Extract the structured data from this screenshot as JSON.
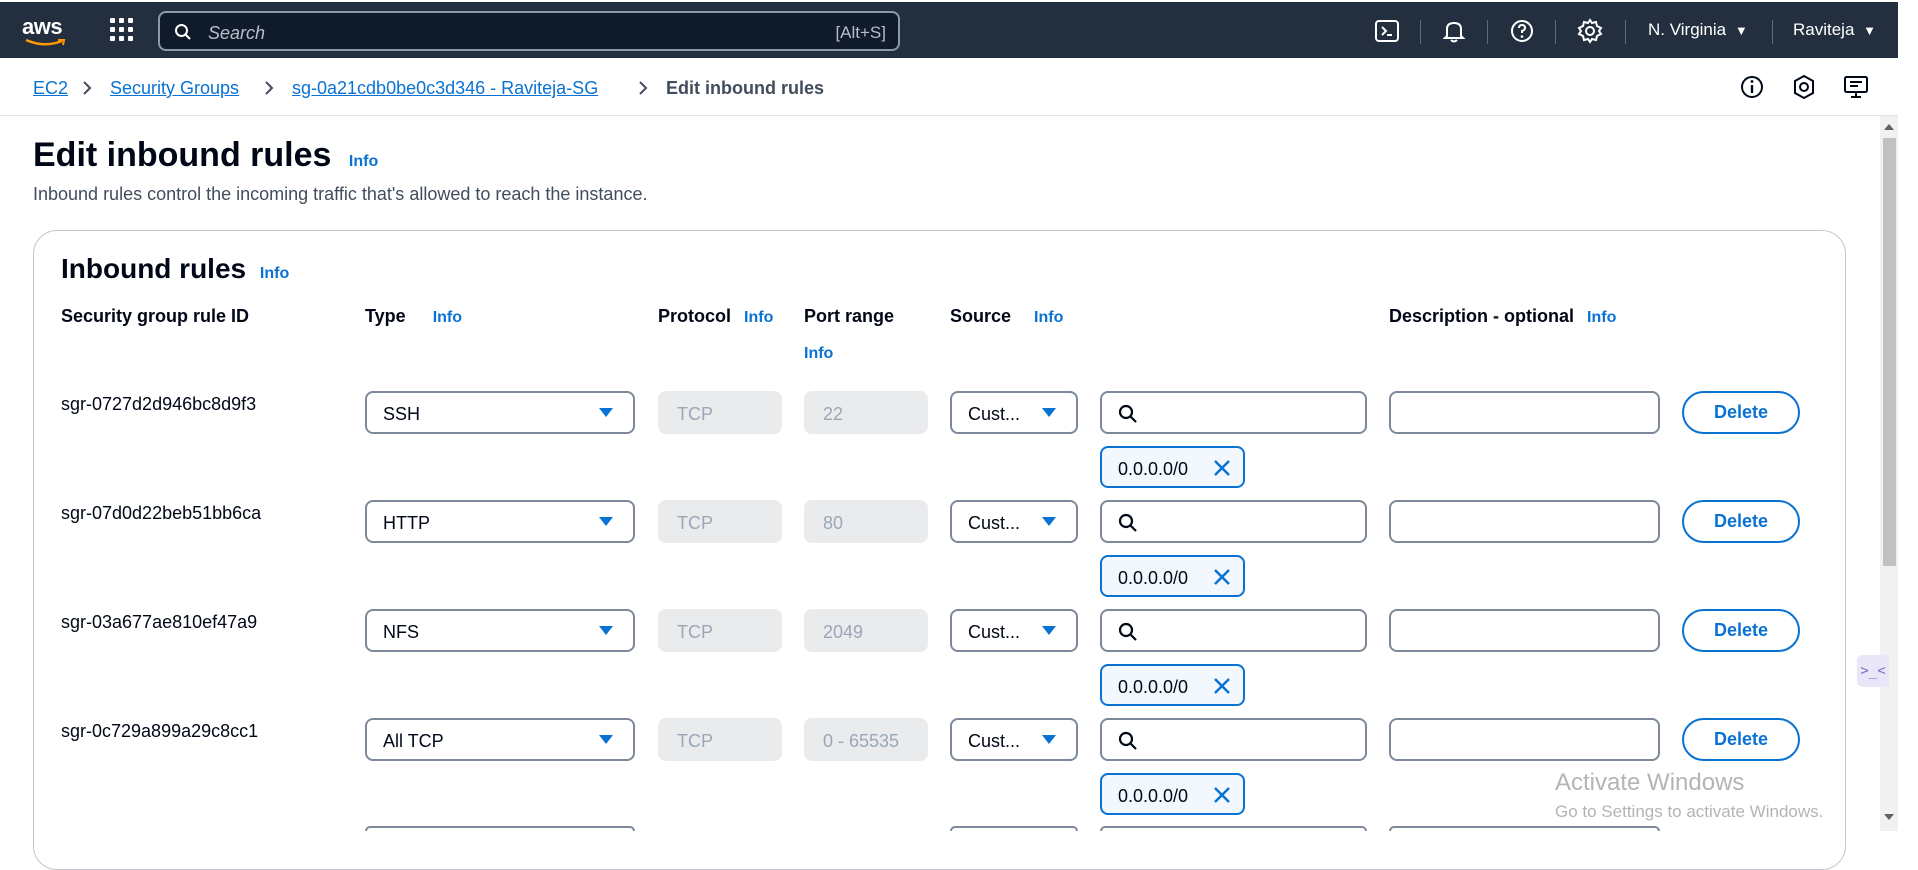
{
  "topnav": {
    "logo": "aws",
    "search_placeholder": "Search",
    "search_shortcut": "[Alt+S]",
    "region": "N. Virginia",
    "user": "Raviteja",
    "icons": [
      "cloudshell-icon",
      "bell-icon",
      "help-icon",
      "gear-icon"
    ]
  },
  "breadcrumb": {
    "items": [
      "EC2",
      "Security Groups",
      "sg-0a21cdb0be0c3d346 - Raviteja-SG"
    ],
    "current": "Edit inbound rules"
  },
  "page": {
    "title": "Edit inbound rules",
    "info": "Info",
    "description": "Inbound rules control the incoming traffic that's allowed to reach the instance."
  },
  "inbound": {
    "title": "Inbound rules",
    "info": "Info",
    "columns": {
      "rule_id": "Security group rule ID",
      "type": "Type",
      "protocol": "Protocol",
      "port_range": "Port range",
      "source": "Source",
      "description": "Description - optional",
      "info": "Info"
    },
    "rules": [
      {
        "id": "sgr-0727d2d946bc8d9f3",
        "type": "SSH",
        "protocol": "TCP",
        "port": "22",
        "source": "Cust...",
        "cidr": "0.0.0.0/0",
        "delete": "Delete"
      },
      {
        "id": "sgr-07d0d22beb51bb6ca",
        "type": "HTTP",
        "protocol": "TCP",
        "port": "80",
        "source": "Cust...",
        "cidr": "0.0.0.0/0",
        "delete": "Delete"
      },
      {
        "id": "sgr-03a677ae810ef47a9",
        "type": "NFS",
        "protocol": "TCP",
        "port": "2049",
        "source": "Cust...",
        "cidr": "0.0.0.0/0",
        "delete": "Delete"
      },
      {
        "id": "sgr-0c729a899a29c8cc1",
        "type": "All TCP",
        "protocol": "TCP",
        "port": "0 - 65535",
        "source": "Cust...",
        "cidr": "0.0.0.0/0",
        "delete": "Delete"
      }
    ]
  },
  "watermark": {
    "line1": "Activate Windows",
    "line2": "Go to Settings to activate Windows."
  },
  "colors": {
    "nav_bg": "#232f3e",
    "link": "#0972d3",
    "text": "#000716",
    "disabled_bg": "#e9ebed"
  }
}
